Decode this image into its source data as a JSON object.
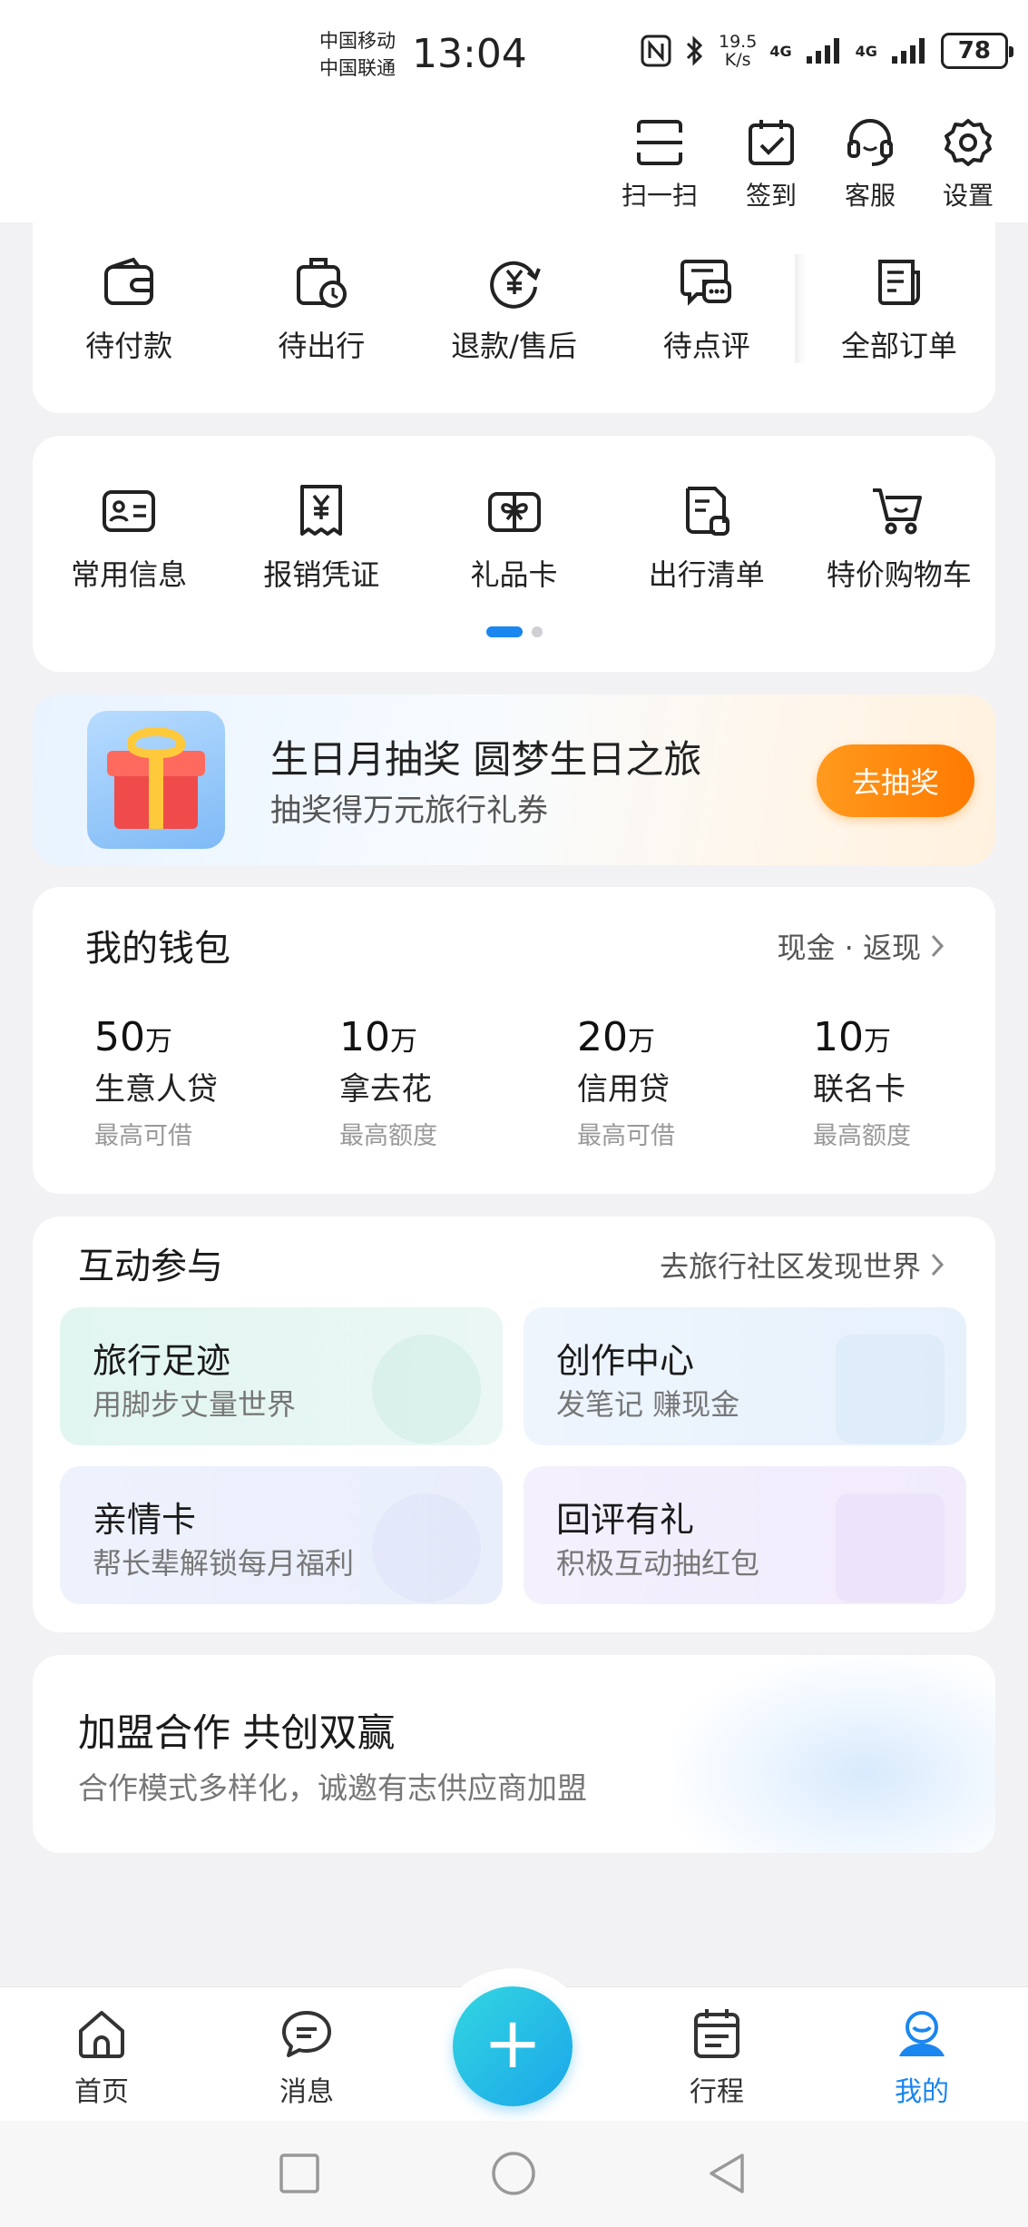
{
  "status_bar": {
    "carrier_1": "中国移动",
    "carrier_2": "中国联通",
    "time": "13:04",
    "speed_value": "19.5",
    "speed_unit": "K/s",
    "network_1": "4G",
    "network_2": "4G",
    "battery": "78"
  },
  "top_actions": [
    {
      "label": "扫一扫",
      "icon": "scan-icon"
    },
    {
      "label": "签到",
      "icon": "calendar-check-icon"
    },
    {
      "label": "客服",
      "icon": "headset-icon"
    },
    {
      "label": "设置",
      "icon": "gear-icon"
    }
  ],
  "orders": [
    {
      "label": "待付款",
      "icon": "wallet-icon"
    },
    {
      "label": "待出行",
      "icon": "luggage-clock-icon"
    },
    {
      "label": "退款/售后",
      "icon": "refund-icon"
    },
    {
      "label": "待点评",
      "icon": "comment-icon"
    },
    {
      "label": "全部订单",
      "icon": "orders-icon"
    }
  ],
  "tools": [
    {
      "label": "常用信息",
      "icon": "id-card-icon"
    },
    {
      "label": "报销凭证",
      "icon": "receipt-icon"
    },
    {
      "label": "礼品卡",
      "icon": "gift-card-icon"
    },
    {
      "label": "出行清单",
      "icon": "checklist-icon"
    },
    {
      "label": "特价购物车",
      "icon": "cart-icon"
    }
  ],
  "tools_page": {
    "current": 1,
    "total": 2
  },
  "banner": {
    "title": "生日月抽奖 圆梦生日之旅",
    "subtitle": "抽奖得万元旅行礼券",
    "button": "去抽奖"
  },
  "wallet": {
    "title": "我的钱包",
    "link": "现金 · 返现",
    "items": [
      {
        "amount": "50",
        "unit": "万",
        "name": "生意人贷",
        "note": "最高可借"
      },
      {
        "amount": "10",
        "unit": "万",
        "name": "拿去花",
        "note": "最高额度"
      },
      {
        "amount": "20",
        "unit": "万",
        "name": "信用贷",
        "note": "最高可借"
      },
      {
        "amount": "10",
        "unit": "万",
        "name": "联名卡",
        "note": "最高额度"
      }
    ]
  },
  "interact": {
    "title": "互动参与",
    "link": "去旅行社区发现世界",
    "tiles": [
      {
        "title": "旅行足迹",
        "subtitle": "用脚步丈量世界"
      },
      {
        "title": "创作中心",
        "subtitle": "发笔记 赚现金"
      },
      {
        "title": "亲情卡",
        "subtitle": "帮长辈解锁每月福利"
      },
      {
        "title": "回评有礼",
        "subtitle": "积极互动抽红包"
      }
    ]
  },
  "join": {
    "title": "加盟合作 共创双赢",
    "subtitle": "合作模式多样化，诚邀有志供应商加盟"
  },
  "bottom_nav": [
    {
      "label": "首页",
      "icon": "home-icon"
    },
    {
      "label": "消息",
      "icon": "message-icon"
    },
    {
      "label": "行程",
      "icon": "itinerary-icon"
    },
    {
      "label": "我的",
      "icon": "profile-icon",
      "active": true
    }
  ],
  "fab": {
    "label": "+"
  },
  "colors": {
    "accent": "#1a86f0",
    "orange": "#ff8a00",
    "fab": "#1aa6ea"
  }
}
